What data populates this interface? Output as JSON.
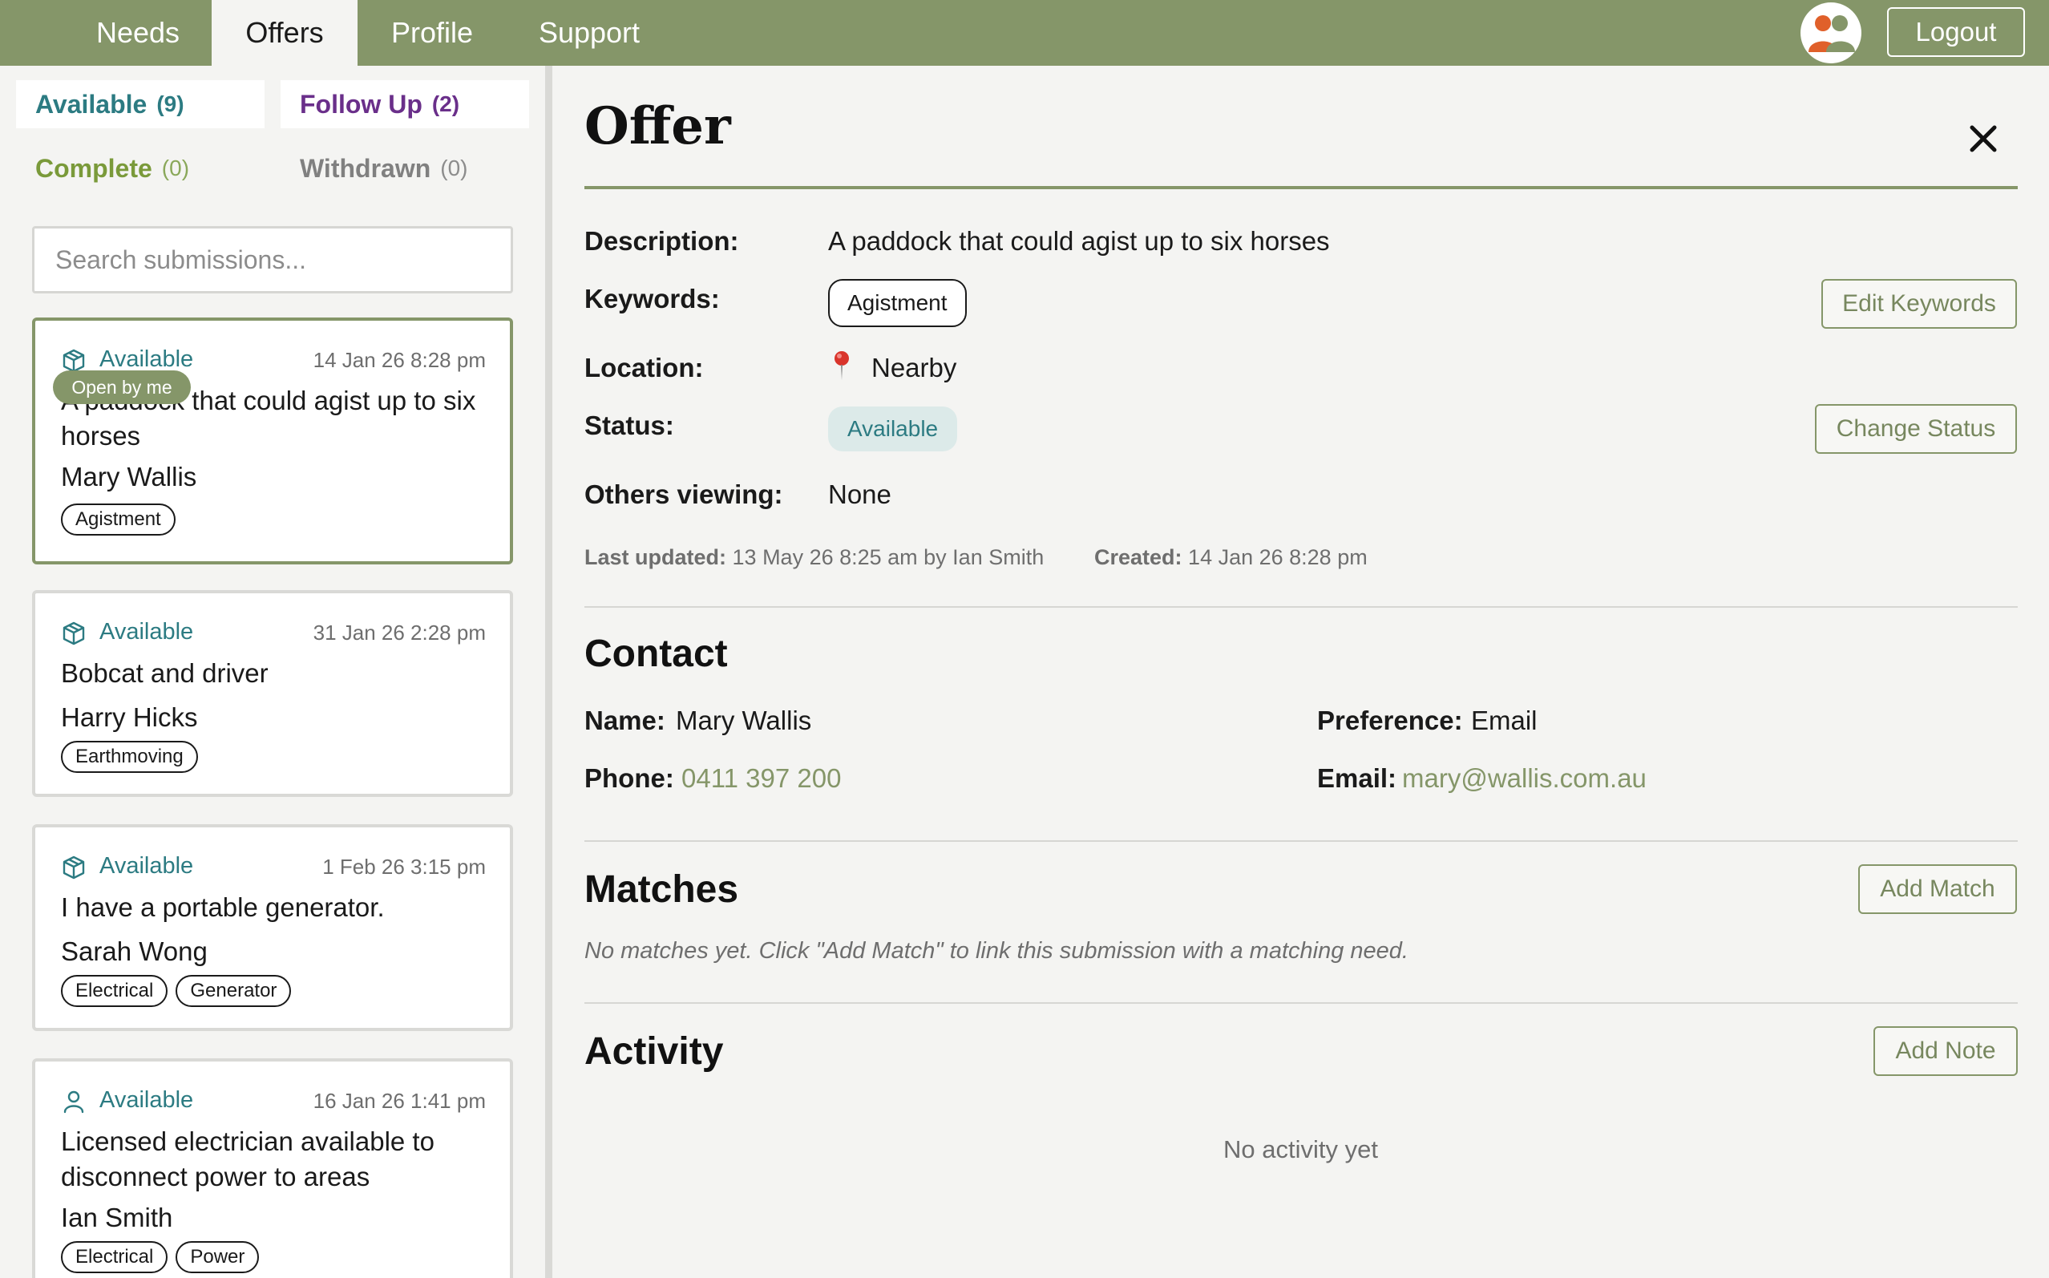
{
  "nav": {
    "tabs": [
      {
        "label": "Needs"
      },
      {
        "label": "Offers"
      },
      {
        "label": "Profile"
      },
      {
        "label": "Support"
      }
    ],
    "logout_label": "Logout",
    "active_tab": "Offers"
  },
  "sidebar": {
    "filters": {
      "available": {
        "label": "Available",
        "count": "(9)"
      },
      "follow_up": {
        "label": "Follow Up",
        "count": "(2)"
      },
      "complete": {
        "label": "Complete",
        "count": "(0)"
      },
      "withdrawn": {
        "label": "Withdrawn",
        "count": "(0)"
      }
    },
    "search_placeholder": "Search submissions...",
    "open_badge": "Open by me",
    "cards": [
      {
        "status": "Available",
        "date": "14 Jan 26 8:28 pm",
        "title": "A paddock that could agist up to six horses",
        "person": "Mary Wallis",
        "tags": [
          "Agistment"
        ],
        "icon": "box-icon"
      },
      {
        "status": "Available",
        "date": "31 Jan 26 2:28 pm",
        "title": "Bobcat and driver",
        "person": "Harry Hicks",
        "tags": [
          "Earthmoving"
        ],
        "icon": "box-icon"
      },
      {
        "status": "Available",
        "date": "1 Feb 26 3:15 pm",
        "title": "I have a portable generator.",
        "person": "Sarah Wong",
        "tags": [
          "Electrical",
          "Generator"
        ],
        "icon": "box-icon"
      },
      {
        "status": "Available",
        "date": "16 Jan 26 1:41 pm",
        "title": "Licensed electrician available to disconnect power to areas",
        "person": "Ian Smith",
        "tags": [
          "Electrical",
          "Power"
        ],
        "icon": "person-icon"
      }
    ]
  },
  "detail": {
    "heading": "Offer",
    "description_label": "Description:",
    "description": "A paddock that could agist up to six horses",
    "keywords_label": "Keywords:",
    "keyword": "Agistment",
    "edit_keywords_label": "Edit Keywords",
    "location_label": "Location:",
    "location": "Nearby",
    "status_label": "Status:",
    "status": "Available",
    "change_status_label": "Change Status",
    "others_label": "Others viewing:",
    "others": "None",
    "last_updated_label": "Last updated:",
    "last_updated": "13 May 26 8:25 am by Ian Smith",
    "created_label": "Created:",
    "created": "14 Jan 26 8:28 pm"
  },
  "contact": {
    "heading": "Contact",
    "name_label": "Name:",
    "name": "Mary Wallis",
    "preference_label": "Preference:",
    "preference": "Email",
    "phone_label": "Phone:",
    "phone": "0411 397 200",
    "email_label": "Email:",
    "email": "mary@wallis.com.au"
  },
  "matches": {
    "heading": "Matches",
    "add_label": "Add Match",
    "empty": "No matches yet. Click \"Add Match\" to link this submission with a matching need."
  },
  "activity": {
    "heading": "Activity",
    "add_label": "Add Note",
    "empty": "No activity yet"
  },
  "colors": {
    "brand": "#859669",
    "available": "#2c7b82",
    "follow_up": "#6a2f8a",
    "complete": "#7a9a3a"
  }
}
